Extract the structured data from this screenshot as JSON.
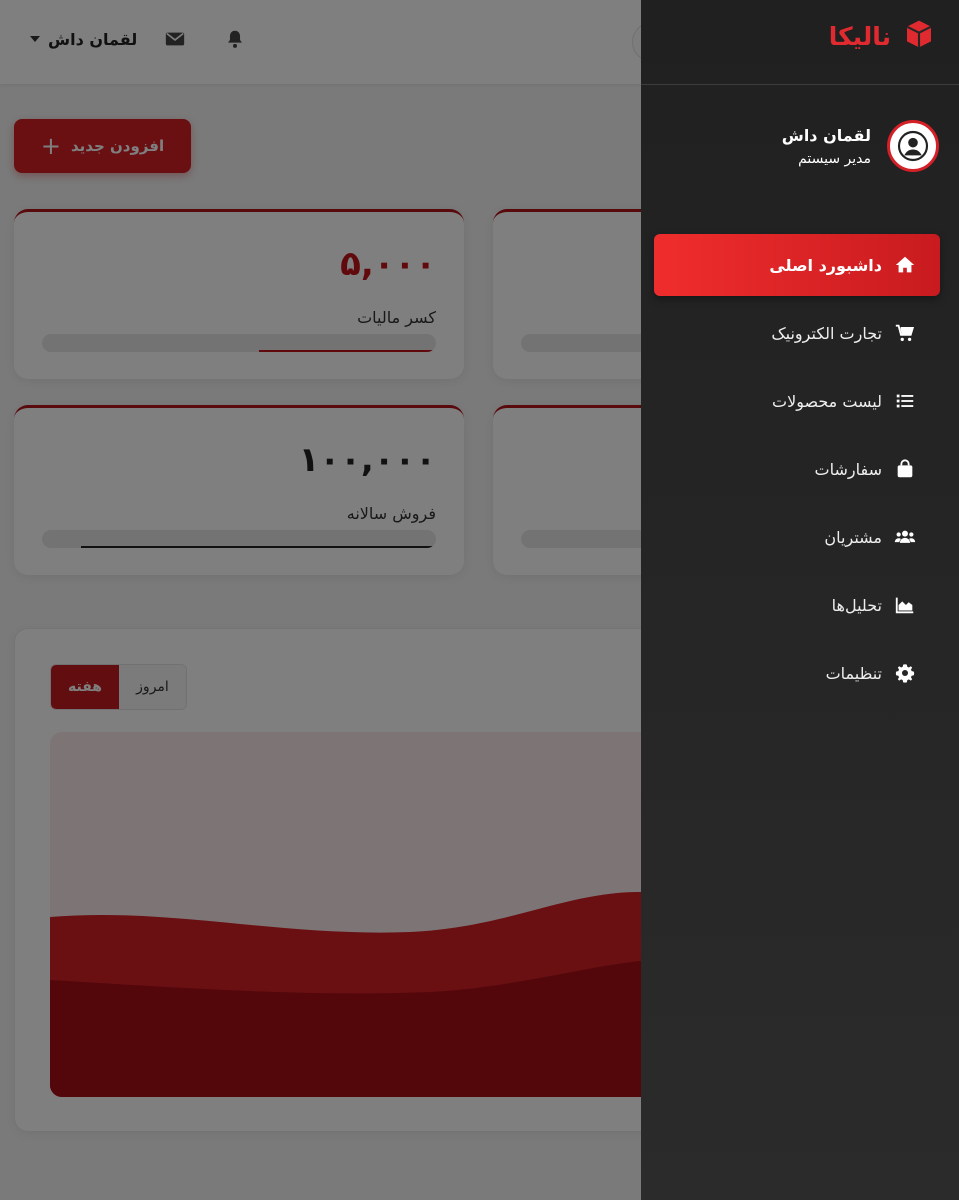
{
  "topbar": {
    "user_name": "لقمان داش"
  },
  "main": {
    "add_button_label": "افزودن جدید",
    "add_button_icon": "plus-icon",
    "cards": [
      {
        "value": "۵,۰۰۰",
        "label": "کسر مالیات",
        "progress": 0.45,
        "value_color": "#c0151b",
        "bar_color": "#c0151b"
      },
      {
        "value": "۱۰۰,۰۰۰",
        "label": "فروش سالانه",
        "progress": 0.9,
        "value_color": "#222222",
        "bar_color": "#222222"
      }
    ],
    "chart_toggle": {
      "active": "هفته",
      "inactive": "امروز"
    }
  },
  "sidebar": {
    "brand": "نالیکا",
    "brand_icon": "cube-icon",
    "profile": {
      "name": "لقمان داش",
      "role": "مدیر سیستم"
    },
    "items": [
      {
        "label": "داشبورد اصلی",
        "icon": "home-icon",
        "active": true
      },
      {
        "label": "تجارت الکترونیک",
        "icon": "cart-icon",
        "active": false
      },
      {
        "label": "لیست محصولات",
        "icon": "list-icon",
        "active": false
      },
      {
        "label": "سفارشات",
        "icon": "bag-icon",
        "active": false
      },
      {
        "label": "مشتریان",
        "icon": "users-icon",
        "active": false
      },
      {
        "label": "تحلیل‌ها",
        "icon": "area-chart-icon",
        "active": false
      },
      {
        "label": "تنظیمات",
        "icon": "gear-icon",
        "active": false
      }
    ]
  },
  "colors": {
    "accent": "#d42026",
    "sidebar_bg": "#262626"
  }
}
